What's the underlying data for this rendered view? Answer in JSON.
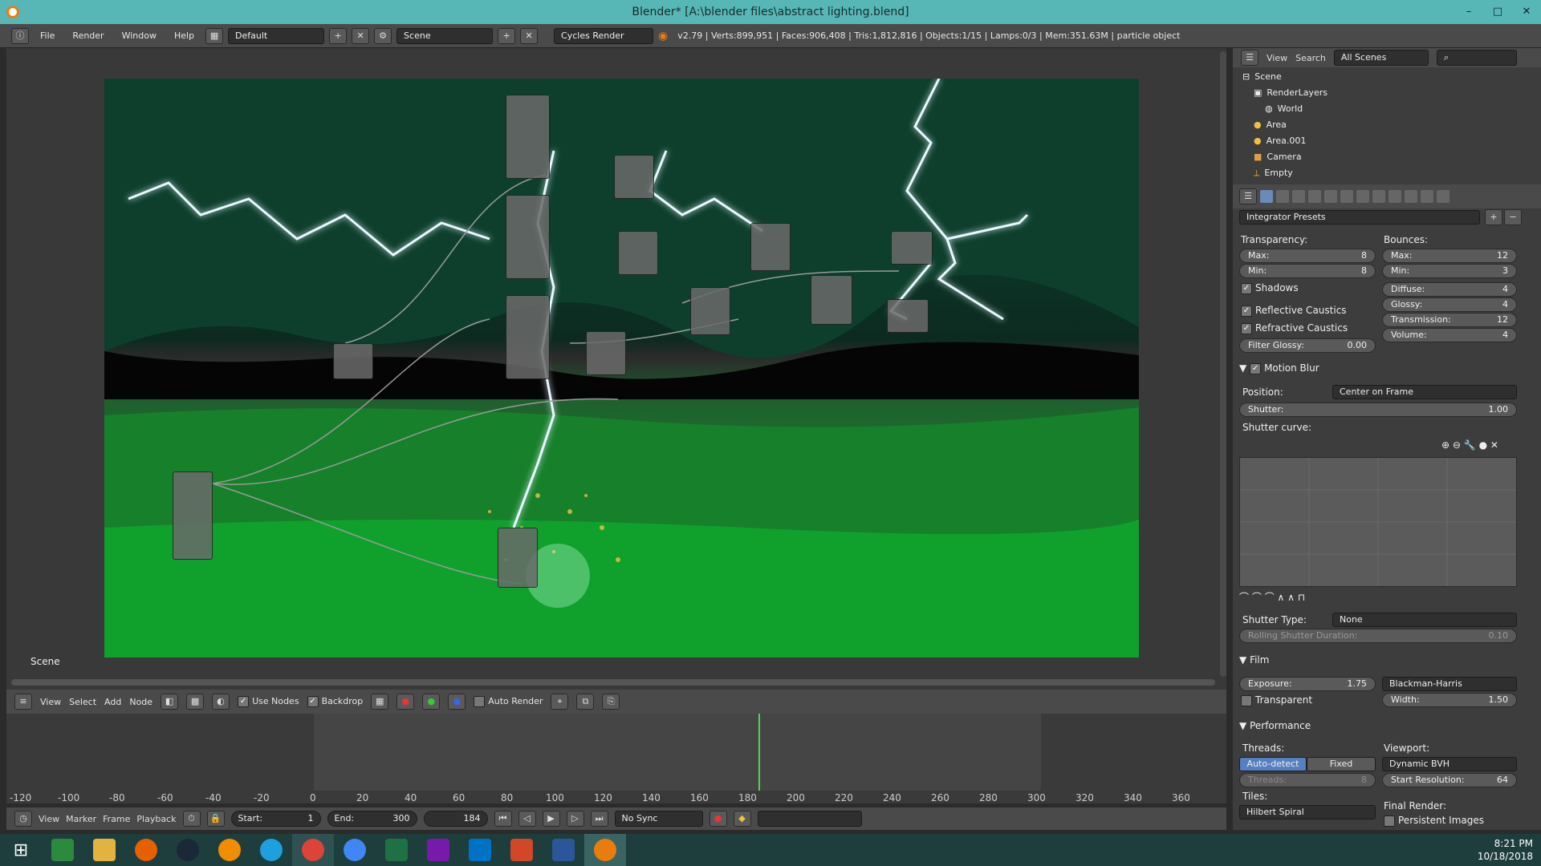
{
  "window": {
    "title": "Blender* [A:\\blender files\\abstract lighting.blend]",
    "minimize": "–",
    "maximize": "□",
    "close": "✕"
  },
  "topbar": {
    "menus": [
      "File",
      "Render",
      "Window",
      "Help"
    ],
    "layout": "Default",
    "scene": "Scene",
    "engine": "Cycles Render",
    "stats": "v2.79 | Verts:899,951 | Faces:906,408 | Tris:1,812,816 | Objects:1/15 | Lamps:0/3 | Mem:351.63M | particle object"
  },
  "node_editor": {
    "label": "Scene",
    "menus": [
      "View",
      "Select",
      "Add",
      "Node"
    ],
    "use_nodes": "Use Nodes",
    "backdrop": "Backdrop",
    "auto_render": "Auto Render"
  },
  "timeline": {
    "ticks": [
      "-120",
      "-100",
      "-80",
      "-60",
      "-40",
      "-20",
      "0",
      "20",
      "40",
      "60",
      "80",
      "100",
      "120",
      "140",
      "160",
      "180",
      "200",
      "220",
      "240",
      "260",
      "280",
      "300",
      "320",
      "340",
      "360"
    ],
    "menus": [
      "View",
      "Marker",
      "Frame",
      "Playback"
    ],
    "start_label": "Start:",
    "start": "1",
    "end_label": "End:",
    "end": "300",
    "current": "184",
    "sync": "No Sync"
  },
  "outliner": {
    "menus": [
      "View",
      "Search"
    ],
    "filter": "All Scenes",
    "items": [
      "Scene",
      "RenderLayers",
      "World",
      "Area",
      "Area.001",
      "Camera",
      "Empty"
    ]
  },
  "properties": {
    "presets": "Integrator Presets",
    "transparency": {
      "label": "Transparency:",
      "max_label": "Max:",
      "max": "8",
      "min_label": "Min:",
      "min": "8"
    },
    "shadows": "Shadows",
    "reflective": "Reflective Caustics",
    "refractive": "Refractive Caustics",
    "filter_glossy_label": "Filter Glossy:",
    "filter_glossy": "0.00",
    "bounces": {
      "label": "Bounces:",
      "max_label": "Max:",
      "max": "12",
      "min_label": "Min:",
      "min": "3",
      "diffuse_label": "Diffuse:",
      "diffuse": "4",
      "glossy_label": "Glossy:",
      "glossy": "4",
      "transmission_label": "Transmission:",
      "transmission": "12",
      "volume_label": "Volume:",
      "volume": "4"
    },
    "motion_blur": {
      "title": "Motion Blur",
      "position_label": "Position:",
      "position": "Center on Frame",
      "shutter_label": "Shutter:",
      "shutter": "1.00",
      "curve_label": "Shutter curve:",
      "type_label": "Shutter Type:",
      "type": "None",
      "rolling_label": "Rolling Shutter Duration:",
      "rolling": "0.10"
    },
    "film": {
      "title": "Film",
      "exposure_label": "Exposure:",
      "exposure": "1.75",
      "filter": "Blackman-Harris",
      "transparent": "Transparent",
      "width_label": "Width:",
      "width": "1.50"
    },
    "performance": {
      "title": "Performance",
      "threads_label": "Threads:",
      "auto": "Auto-detect",
      "fixed": "Fixed",
      "threads_field_label": "Threads:",
      "threads": "8",
      "viewport_label": "Viewport:",
      "viewport": "Dynamic BVH",
      "startres_label": "Start Resolution:",
      "startres": "64",
      "tiles_label": "Tiles:",
      "tiles": "Hilbert Spiral",
      "final_label": "Final Render:",
      "persistent": "Persistent Images"
    }
  },
  "tray": {
    "time": "8:21 PM",
    "date": "10/18/2018"
  },
  "taskbar_icons": [
    "windows-start-icon",
    "store-icon",
    "file-explorer-icon",
    "firefox-icon",
    "steam-icon",
    "half-life-icon",
    "internet-explorer-icon",
    "chrome-icon",
    "chrome-alt-icon",
    "excel-icon",
    "onenote-icon",
    "outlook-icon",
    "powerpoint-icon",
    "word-icon",
    "blender-icon"
  ]
}
